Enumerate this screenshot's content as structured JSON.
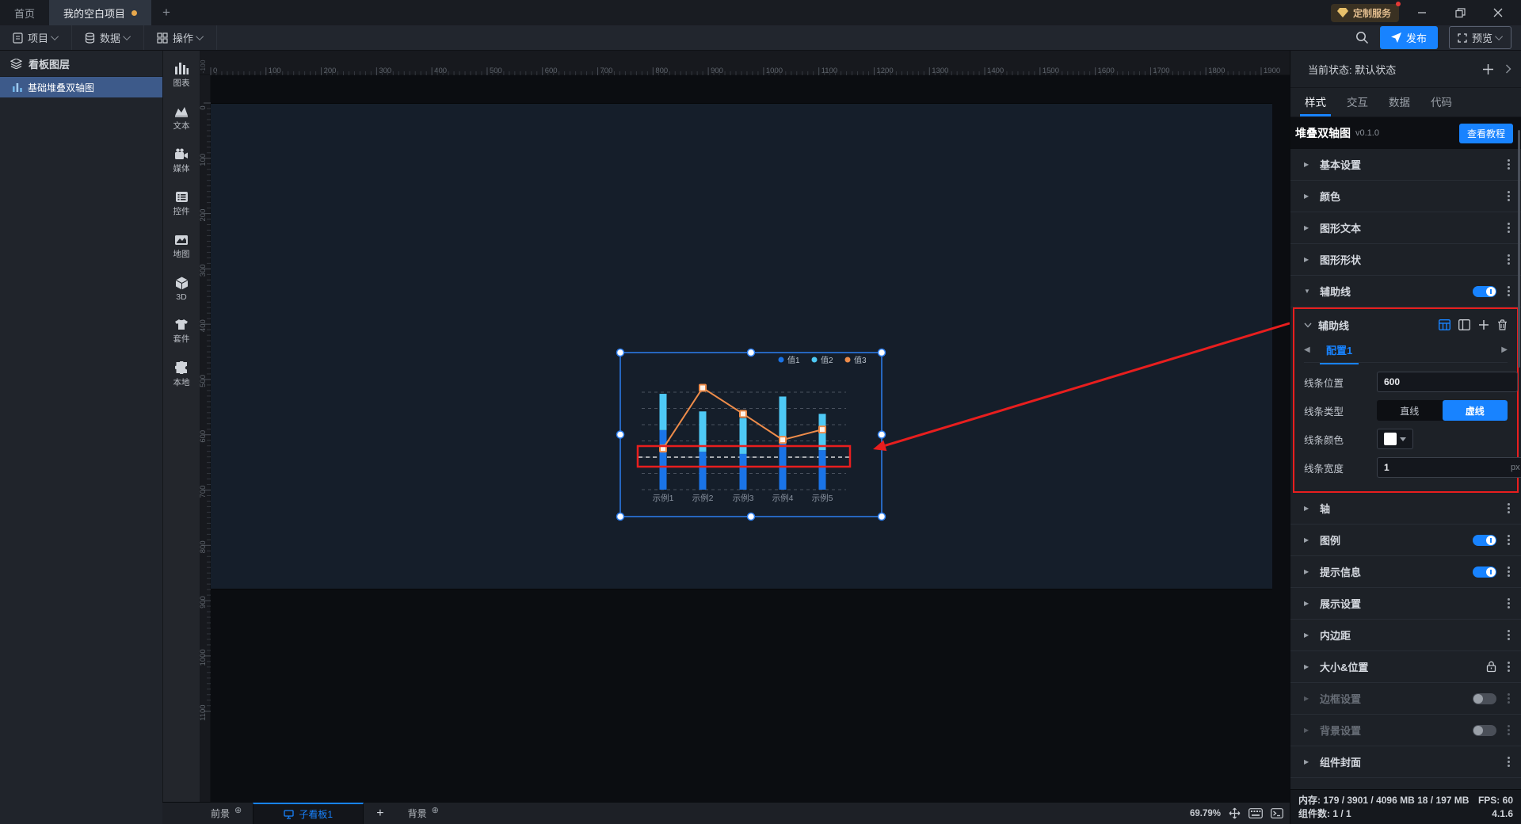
{
  "titlebar": {
    "home_tab": "首页",
    "project_tab": "我的空白项目",
    "new_tab": "+",
    "custom_service": "定制服务"
  },
  "menubar": {
    "project": "项目",
    "data": "数据",
    "operation": "操作",
    "publish": "发布",
    "preview": "预览"
  },
  "layers_panel": {
    "header": "看板图层",
    "items": [
      {
        "label": "基础堆叠双轴图",
        "selected": true
      }
    ]
  },
  "strip": {
    "items": [
      "图表",
      "文本",
      "媒体",
      "控件",
      "地图",
      "3D",
      "套件",
      "本地"
    ]
  },
  "canvas": {
    "zoom": "69.79%",
    "ruler": {
      "h_start": 0,
      "h_end": 1900,
      "v_start": 0,
      "v_end": 1100,
      "step": 100,
      "scale": 0.6979,
      "negative_label": "-100"
    }
  },
  "chart_data": {
    "type": "bar",
    "subtype": "stacked-bars-with-line",
    "categories": [
      "示例1",
      "示例2",
      "示例3",
      "示例4",
      "示例5"
    ],
    "series": [
      {
        "name": "值1",
        "kind": "bar",
        "stack": true,
        "color": "#1a74e8",
        "values": [
          1100,
          700,
          660,
          900,
          730
        ]
      },
      {
        "name": "值2",
        "kind": "bar",
        "stack": true,
        "color": "#4ec9f5",
        "values": [
          670,
          745,
          660,
          820,
          670
        ]
      },
      {
        "name": "值3",
        "kind": "line",
        "color": "#ee8c4a",
        "values": [
          760,
          1880,
          1400,
          920,
          1110
        ]
      }
    ],
    "ylim": [
      0,
      2000
    ],
    "grid_step": 300,
    "grid_max": 1800,
    "grid": "dashed",
    "legend_position": "top-right",
    "auxiliary_line": {
      "position": 600,
      "type": "dashed",
      "color": "#ffffff",
      "width": 1
    },
    "title": ""
  },
  "bottom_bar": {
    "foreground": "前景",
    "board_tab": "子看板1",
    "add": "+",
    "background": "背景"
  },
  "right_panel": {
    "state_label": "当前状态:",
    "state_value": "默认状态",
    "tabs": [
      {
        "label": "样式",
        "active": true
      },
      {
        "label": "交互",
        "active": false
      },
      {
        "label": "数据",
        "active": false
      },
      {
        "label": "代码",
        "active": false
      }
    ],
    "component_title": "堆叠双轴图",
    "component_version": "v0.1.0",
    "tutorial_btn": "查看教程",
    "sections_top": [
      {
        "key": "basic",
        "label": "基本设置"
      },
      {
        "key": "color",
        "label": "颜色"
      },
      {
        "key": "graphic-text",
        "label": "图形文本"
      },
      {
        "key": "graphic-shape",
        "label": "图形形状"
      },
      {
        "key": "aux-line",
        "label": "辅助线",
        "expanded": true,
        "toggle": "on"
      }
    ],
    "aux_panel": {
      "title": "辅助线",
      "tab": "配置1",
      "fields": {
        "position": {
          "label": "线条位置",
          "value": "600"
        },
        "line_type": {
          "label": "线条类型",
          "options": [
            "直线",
            "虚线"
          ],
          "selected": "虚线"
        },
        "color": {
          "label": "线条颜色",
          "value": "#ffffff"
        },
        "width": {
          "label": "线条宽度",
          "value": "1",
          "suffix": "px"
        }
      }
    },
    "sections_bottom": [
      {
        "key": "axis",
        "label": "轴"
      },
      {
        "key": "legend",
        "label": "图例",
        "toggle": "on"
      },
      {
        "key": "tooltip",
        "label": "提示信息",
        "toggle": "on"
      },
      {
        "key": "display",
        "label": "展示设置"
      },
      {
        "key": "padding",
        "label": "内边距"
      },
      {
        "key": "size-position",
        "label": "大小&位置",
        "lock": true
      },
      {
        "key": "border",
        "label": "边框设置",
        "toggle": "off",
        "disabled": true
      },
      {
        "key": "background",
        "label": "背景设置",
        "toggle": "off",
        "disabled": true
      },
      {
        "key": "cover",
        "label": "组件封面"
      }
    ],
    "accent_color": "#1883ff",
    "annotation_color": "#e81e1e"
  },
  "status_bar": {
    "memory_label": "内存:",
    "memory_value": "179 / 3901 / 4096 MB  18 / 197 MB",
    "fps_label": "FPS:",
    "fps_value": "60",
    "components_label": "组件数:",
    "components_value": "1 / 1",
    "version": "4.1.6"
  }
}
